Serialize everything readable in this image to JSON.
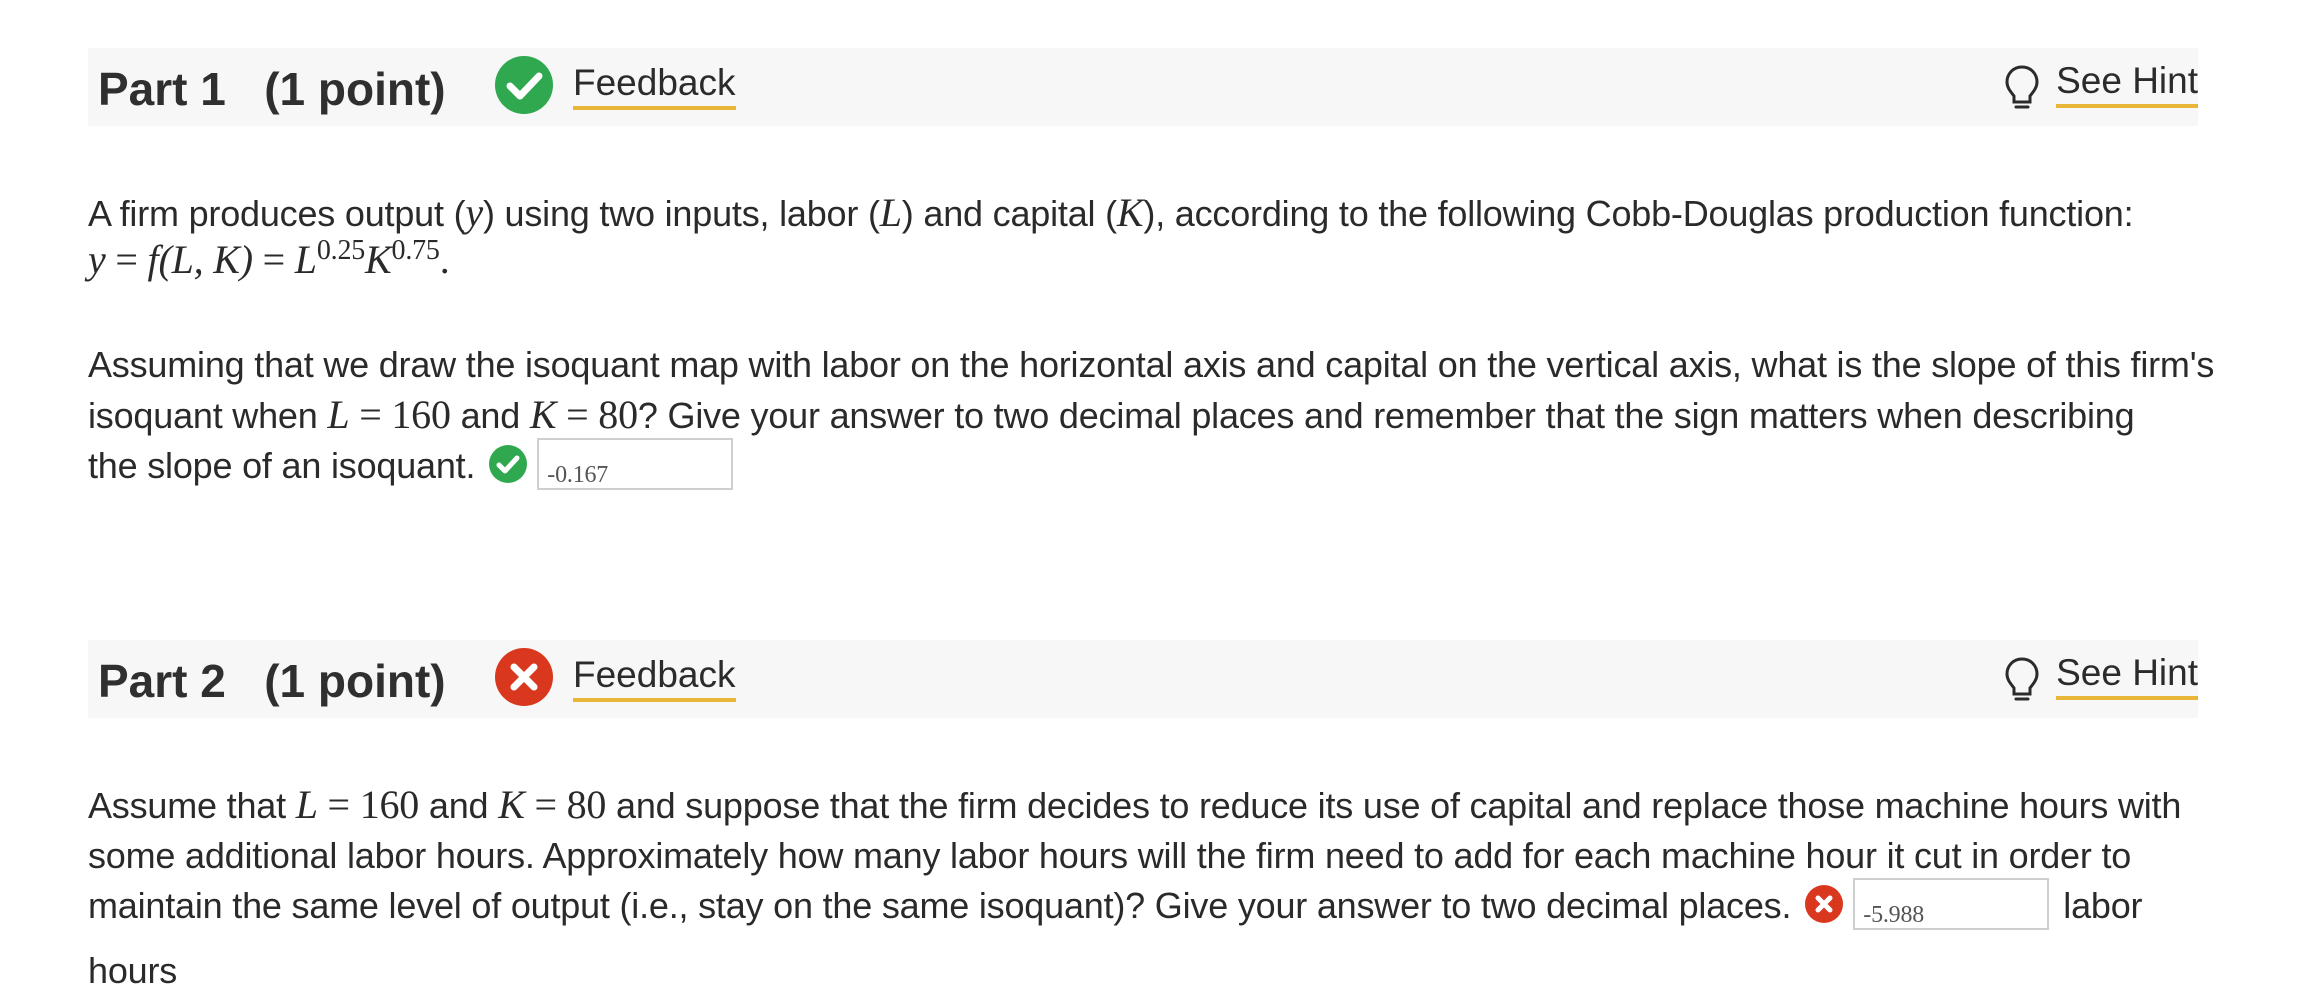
{
  "part1": {
    "title": "Part 1   (1 point)",
    "status": "correct",
    "feedback_label": "Feedback",
    "hint_label": "See Hint",
    "intro": {
      "t1": "A firm produces output (",
      "y": "y",
      "t2": ") using two inputs, labor (",
      "L": "L",
      "t3": ") and capital (",
      "K": "K",
      "t4": "), according to the following Cobb-Douglas production function:",
      "formula_lhs": "y",
      "formula_mid": " = ",
      "formula_f": "f",
      "formula_args": "(L, K)",
      "formula_eq": " = ",
      "formula_L": "L",
      "exp_L": "0.25",
      "formula_K": "K",
      "exp_K": "0.75",
      "formula_end": "."
    },
    "question": {
      "t1": "Assuming that we draw the isoquant map with labor on the horizontal axis and capital on the vertical axis, what is the slope of this firm's",
      "t2": "isoquant when ",
      "L": "L",
      "eq1": " = 160",
      "t3": " and ",
      "K": "K",
      "eq2": " = 80",
      "t4": "? Give your answer to two decimal places and remember that the sign matters when describing",
      "t5": "the slope of an isoquant."
    },
    "answer_value": "-0.167"
  },
  "part2": {
    "title": "Part 2   (1 point)",
    "status": "incorrect",
    "feedback_label": "Feedback",
    "hint_label": "See Hint",
    "question": {
      "t1": "Assume that ",
      "L": "L",
      "eq1": " = 160",
      "t2": " and ",
      "K": "K",
      "eq2": " = 80",
      "t3": " and suppose that the firm decides to reduce its use of capital and replace those machine hours with",
      "t4": "some additional labor hours. Approximately how many labor hours will the firm need to add for each machine hour it cut in order to",
      "t5": "maintain the same level of output (i.e., stay on the same isoquant)? Give your answer to two decimal places.",
      "unit_1": "labor",
      "unit_2": "hours"
    },
    "answer_value": "-5.988"
  },
  "colors": {
    "correct": "#2fa84f",
    "incorrect": "#d9381e",
    "link_underline": "#e8b73a",
    "header_bg": "#f7f7f7"
  }
}
